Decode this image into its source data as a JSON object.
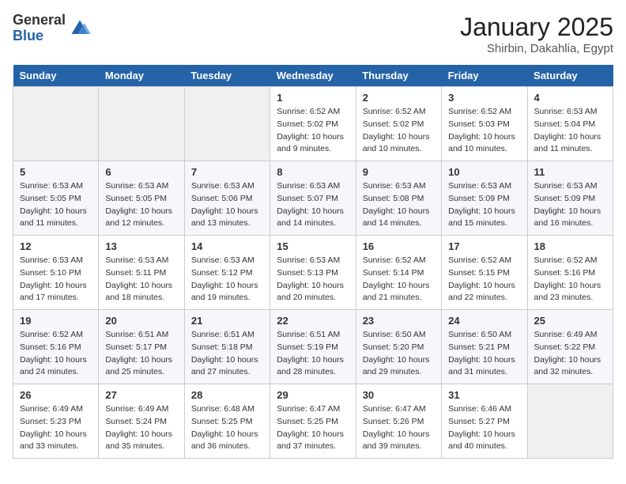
{
  "header": {
    "logo_general": "General",
    "logo_blue": "Blue",
    "title": "January 2025",
    "subtitle": "Shirbin, Dakahlia, Egypt"
  },
  "weekdays": [
    "Sunday",
    "Monday",
    "Tuesday",
    "Wednesday",
    "Thursday",
    "Friday",
    "Saturday"
  ],
  "weeks": [
    [
      {
        "day": "",
        "sunrise": "",
        "sunset": "",
        "daylight": ""
      },
      {
        "day": "",
        "sunrise": "",
        "sunset": "",
        "daylight": ""
      },
      {
        "day": "",
        "sunrise": "",
        "sunset": "",
        "daylight": ""
      },
      {
        "day": "1",
        "sunrise": "Sunrise: 6:52 AM",
        "sunset": "Sunset: 5:02 PM",
        "daylight": "Daylight: 10 hours and 9 minutes."
      },
      {
        "day": "2",
        "sunrise": "Sunrise: 6:52 AM",
        "sunset": "Sunset: 5:02 PM",
        "daylight": "Daylight: 10 hours and 10 minutes."
      },
      {
        "day": "3",
        "sunrise": "Sunrise: 6:52 AM",
        "sunset": "Sunset: 5:03 PM",
        "daylight": "Daylight: 10 hours and 10 minutes."
      },
      {
        "day": "4",
        "sunrise": "Sunrise: 6:53 AM",
        "sunset": "Sunset: 5:04 PM",
        "daylight": "Daylight: 10 hours and 11 minutes."
      }
    ],
    [
      {
        "day": "5",
        "sunrise": "Sunrise: 6:53 AM",
        "sunset": "Sunset: 5:05 PM",
        "daylight": "Daylight: 10 hours and 11 minutes."
      },
      {
        "day": "6",
        "sunrise": "Sunrise: 6:53 AM",
        "sunset": "Sunset: 5:05 PM",
        "daylight": "Daylight: 10 hours and 12 minutes."
      },
      {
        "day": "7",
        "sunrise": "Sunrise: 6:53 AM",
        "sunset": "Sunset: 5:06 PM",
        "daylight": "Daylight: 10 hours and 13 minutes."
      },
      {
        "day": "8",
        "sunrise": "Sunrise: 6:53 AM",
        "sunset": "Sunset: 5:07 PM",
        "daylight": "Daylight: 10 hours and 14 minutes."
      },
      {
        "day": "9",
        "sunrise": "Sunrise: 6:53 AM",
        "sunset": "Sunset: 5:08 PM",
        "daylight": "Daylight: 10 hours and 14 minutes."
      },
      {
        "day": "10",
        "sunrise": "Sunrise: 6:53 AM",
        "sunset": "Sunset: 5:09 PM",
        "daylight": "Daylight: 10 hours and 15 minutes."
      },
      {
        "day": "11",
        "sunrise": "Sunrise: 6:53 AM",
        "sunset": "Sunset: 5:09 PM",
        "daylight": "Daylight: 10 hours and 16 minutes."
      }
    ],
    [
      {
        "day": "12",
        "sunrise": "Sunrise: 6:53 AM",
        "sunset": "Sunset: 5:10 PM",
        "daylight": "Daylight: 10 hours and 17 minutes."
      },
      {
        "day": "13",
        "sunrise": "Sunrise: 6:53 AM",
        "sunset": "Sunset: 5:11 PM",
        "daylight": "Daylight: 10 hours and 18 minutes."
      },
      {
        "day": "14",
        "sunrise": "Sunrise: 6:53 AM",
        "sunset": "Sunset: 5:12 PM",
        "daylight": "Daylight: 10 hours and 19 minutes."
      },
      {
        "day": "15",
        "sunrise": "Sunrise: 6:53 AM",
        "sunset": "Sunset: 5:13 PM",
        "daylight": "Daylight: 10 hours and 20 minutes."
      },
      {
        "day": "16",
        "sunrise": "Sunrise: 6:52 AM",
        "sunset": "Sunset: 5:14 PM",
        "daylight": "Daylight: 10 hours and 21 minutes."
      },
      {
        "day": "17",
        "sunrise": "Sunrise: 6:52 AM",
        "sunset": "Sunset: 5:15 PM",
        "daylight": "Daylight: 10 hours and 22 minutes."
      },
      {
        "day": "18",
        "sunrise": "Sunrise: 6:52 AM",
        "sunset": "Sunset: 5:16 PM",
        "daylight": "Daylight: 10 hours and 23 minutes."
      }
    ],
    [
      {
        "day": "19",
        "sunrise": "Sunrise: 6:52 AM",
        "sunset": "Sunset: 5:16 PM",
        "daylight": "Daylight: 10 hours and 24 minutes."
      },
      {
        "day": "20",
        "sunrise": "Sunrise: 6:51 AM",
        "sunset": "Sunset: 5:17 PM",
        "daylight": "Daylight: 10 hours and 25 minutes."
      },
      {
        "day": "21",
        "sunrise": "Sunrise: 6:51 AM",
        "sunset": "Sunset: 5:18 PM",
        "daylight": "Daylight: 10 hours and 27 minutes."
      },
      {
        "day": "22",
        "sunrise": "Sunrise: 6:51 AM",
        "sunset": "Sunset: 5:19 PM",
        "daylight": "Daylight: 10 hours and 28 minutes."
      },
      {
        "day": "23",
        "sunrise": "Sunrise: 6:50 AM",
        "sunset": "Sunset: 5:20 PM",
        "daylight": "Daylight: 10 hours and 29 minutes."
      },
      {
        "day": "24",
        "sunrise": "Sunrise: 6:50 AM",
        "sunset": "Sunset: 5:21 PM",
        "daylight": "Daylight: 10 hours and 31 minutes."
      },
      {
        "day": "25",
        "sunrise": "Sunrise: 6:49 AM",
        "sunset": "Sunset: 5:22 PM",
        "daylight": "Daylight: 10 hours and 32 minutes."
      }
    ],
    [
      {
        "day": "26",
        "sunrise": "Sunrise: 6:49 AM",
        "sunset": "Sunset: 5:23 PM",
        "daylight": "Daylight: 10 hours and 33 minutes."
      },
      {
        "day": "27",
        "sunrise": "Sunrise: 6:49 AM",
        "sunset": "Sunset: 5:24 PM",
        "daylight": "Daylight: 10 hours and 35 minutes."
      },
      {
        "day": "28",
        "sunrise": "Sunrise: 6:48 AM",
        "sunset": "Sunset: 5:25 PM",
        "daylight": "Daylight: 10 hours and 36 minutes."
      },
      {
        "day": "29",
        "sunrise": "Sunrise: 6:47 AM",
        "sunset": "Sunset: 5:25 PM",
        "daylight": "Daylight: 10 hours and 37 minutes."
      },
      {
        "day": "30",
        "sunrise": "Sunrise: 6:47 AM",
        "sunset": "Sunset: 5:26 PM",
        "daylight": "Daylight: 10 hours and 39 minutes."
      },
      {
        "day": "31",
        "sunrise": "Sunrise: 6:46 AM",
        "sunset": "Sunset: 5:27 PM",
        "daylight": "Daylight: 10 hours and 40 minutes."
      },
      {
        "day": "",
        "sunrise": "",
        "sunset": "",
        "daylight": ""
      }
    ]
  ]
}
